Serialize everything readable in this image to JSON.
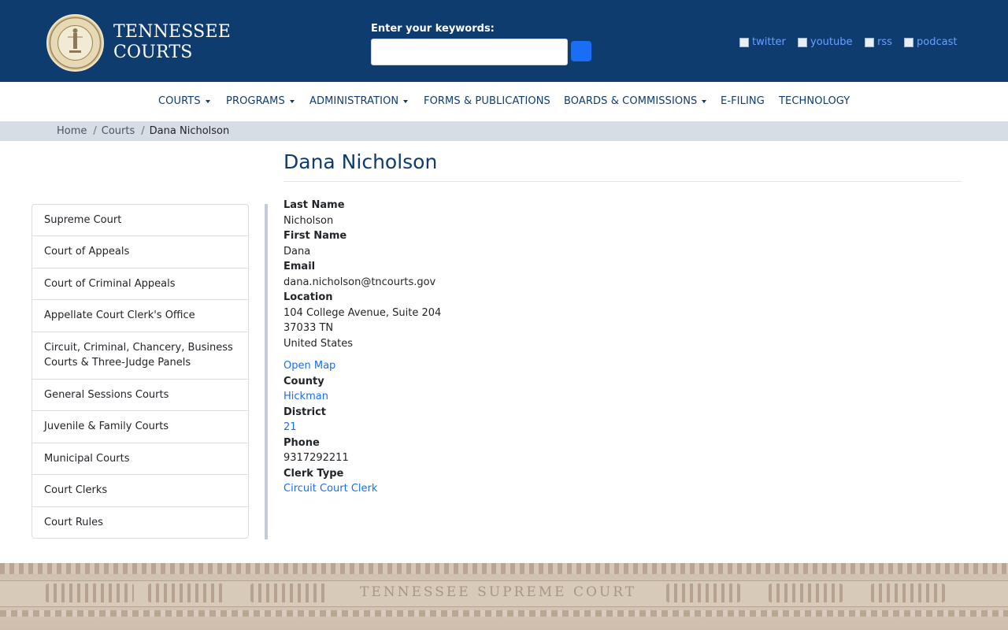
{
  "header": {
    "brand_line1": "TENNESSEE",
    "brand_line2": "COURTS",
    "search_label": "Enter your keywords:",
    "search_value": "",
    "social": [
      "twitter",
      "youtube",
      "rss",
      "podcast"
    ]
  },
  "nav": [
    {
      "label": "COURTS",
      "dropdown": true
    },
    {
      "label": "PROGRAMS",
      "dropdown": true
    },
    {
      "label": "ADMINISTRATION",
      "dropdown": true
    },
    {
      "label": "FORMS & PUBLICATIONS",
      "dropdown": false
    },
    {
      "label": "BOARDS & COMMISSIONS",
      "dropdown": true
    },
    {
      "label": "E-FILING",
      "dropdown": false
    },
    {
      "label": "TECHNOLOGY",
      "dropdown": false
    }
  ],
  "breadcrumb": [
    "Home",
    "Courts",
    "Dana Nicholson"
  ],
  "page_title": "Dana Nicholson",
  "sidebar": [
    "Supreme Court",
    "Court of Appeals",
    "Court of Criminal Appeals",
    "Appellate Court Clerk's Office",
    "Circuit, Criminal, Chancery, Business Courts & Three-Judge Panels",
    "General Sessions Courts",
    "Juvenile & Family Courts",
    "Municipal Courts",
    "Court Clerks",
    "Court Rules"
  ],
  "details": {
    "last_name_label": "Last Name",
    "last_name": "Nicholson",
    "first_name_label": "First Name",
    "first_name": "Dana",
    "email_label": "Email",
    "email": "dana.nicholson@tncourts.gov",
    "location_label": "Location",
    "address_line1": "104 College Avenue, Suite 204",
    "address_line2": "37033 TN",
    "address_line3": "United States",
    "open_map": "Open Map",
    "county_label": "County",
    "county": "Hickman",
    "district_label": "District",
    "district": "21",
    "phone_label": "Phone",
    "phone": "9317292211",
    "clerk_type_label": "Clerk Type",
    "clerk_type": "Circuit Court Clerk"
  },
  "footer": {
    "frieze_text": "TENNESSEE SUPREME COURT"
  },
  "colors": {
    "header_bg": "#0f3c6e",
    "link": "#1a6ef6",
    "breadcrumb_bg": "#d6dde5"
  }
}
